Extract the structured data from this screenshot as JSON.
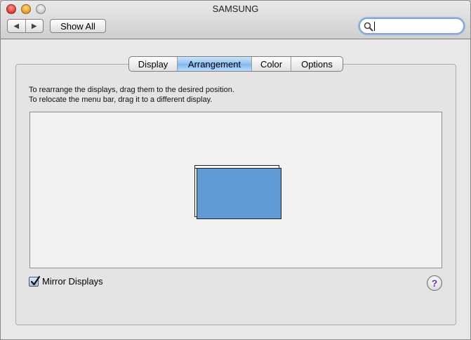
{
  "window": {
    "title": "SAMSUNG"
  },
  "toolbar": {
    "back_icon": "back-arrow-icon",
    "forward_icon": "forward-arrow-icon",
    "back_glyph": "◀",
    "forward_glyph": "▶",
    "show_all_label": "Show All",
    "search": {
      "value": "",
      "placeholder": ""
    }
  },
  "tabs": [
    {
      "label": "Display",
      "active": false
    },
    {
      "label": "Arrangement",
      "active": true
    },
    {
      "label": "Color",
      "active": false
    },
    {
      "label": "Options",
      "active": false
    }
  ],
  "main": {
    "instruction_line1": "To rearrange the displays, drag them to the desired position.",
    "instruction_line2": "To relocate the menu bar, drag it to a different display.",
    "mirror_label": "Mirror Displays",
    "mirror_checked": true,
    "help_glyph": "?"
  },
  "colors": {
    "display_fill": "#6199d4",
    "active_tab": "#8ec2f3",
    "help_glyph": "#6b2fb2"
  }
}
